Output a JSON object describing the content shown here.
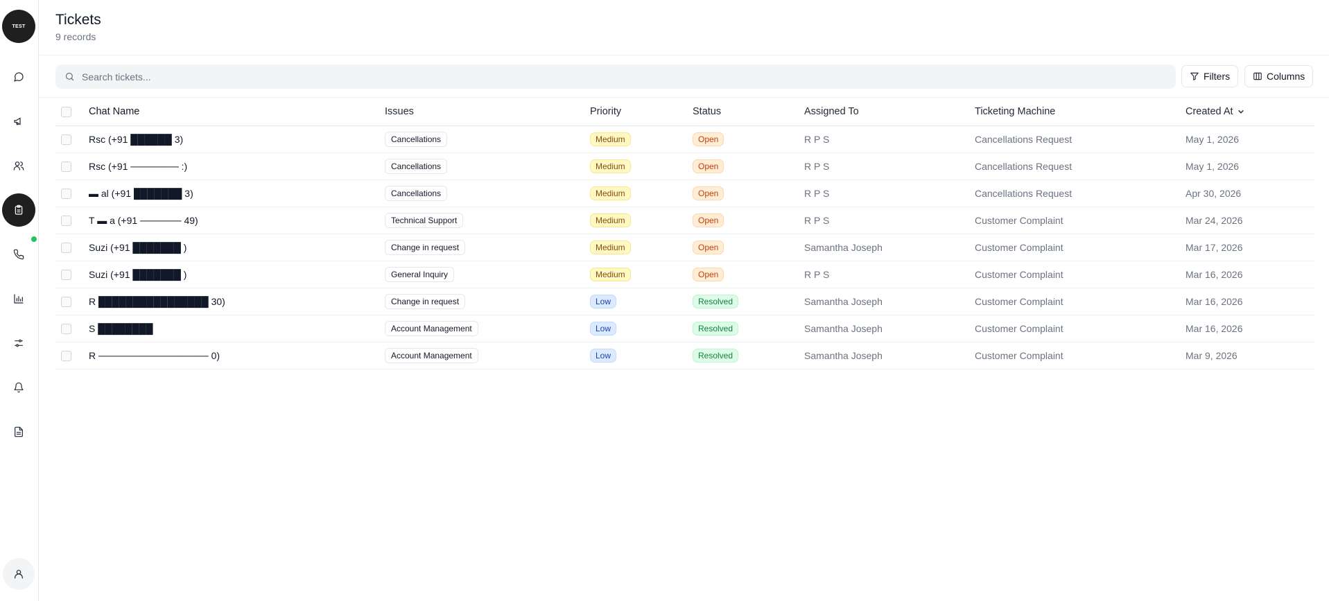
{
  "sidebar": {
    "logo_text": "TEST",
    "items": [
      {
        "name": "chat-icon",
        "top": 0
      },
      {
        "name": "megaphone-icon"
      },
      {
        "name": "users-icon"
      },
      {
        "name": "clipboard-icon",
        "active": true
      },
      {
        "name": "phone-icon"
      },
      {
        "name": "bar-chart-icon"
      },
      {
        "name": "sliders-icon"
      },
      {
        "name": "bell-icon"
      },
      {
        "name": "document-icon"
      }
    ],
    "profile_icon": "user-icon",
    "status_color": "#22c55e"
  },
  "header": {
    "title": "Tickets",
    "record_count": "9 records"
  },
  "toolbar": {
    "search_placeholder": "Search tickets...",
    "filters_label": "Filters",
    "columns_label": "Columns"
  },
  "table": {
    "columns": {
      "chat_name": "Chat Name",
      "issues": "Issues",
      "priority": "Priority",
      "status": "Status",
      "assigned_to": "Assigned To",
      "ticketing_machine": "Ticketing Machine",
      "created_at": "Created At"
    },
    "rows": [
      {
        "chat_name": "Rsc (+91 ██████ 3)",
        "issue": "Cancellations",
        "priority": "Medium",
        "status": "Open",
        "assigned_to": "R P S",
        "machine": "Cancellations Request",
        "created_at": "May 1, 2026"
      },
      {
        "chat_name": "Rsc (+91 ─────── :)",
        "issue": "Cancellations",
        "priority": "Medium",
        "status": "Open",
        "assigned_to": "R P S",
        "machine": "Cancellations Request",
        "created_at": "May 1, 2026"
      },
      {
        "chat_name": "▬ al (+91 ███████ 3)",
        "issue": "Cancellations",
        "priority": "Medium",
        "status": "Open",
        "assigned_to": "R P S",
        "machine": "Cancellations Request",
        "created_at": "Apr 30, 2026"
      },
      {
        "chat_name": "T ▬ a (+91 ────── 49)",
        "issue": "Technical Support",
        "priority": "Medium",
        "status": "Open",
        "assigned_to": "R P S",
        "machine": "Customer Complaint",
        "created_at": "Mar 24, 2026"
      },
      {
        "chat_name": "Suzi (+91 ███████ )",
        "issue": "Change in request",
        "priority": "Medium",
        "status": "Open",
        "assigned_to": "Samantha Joseph",
        "machine": "Customer Complaint",
        "created_at": "Mar 17, 2026"
      },
      {
        "chat_name": "Suzi (+91 ███████ )",
        "issue": "General Inquiry",
        "priority": "Medium",
        "status": "Open",
        "assigned_to": "R P S",
        "machine": "Customer Complaint",
        "created_at": "Mar 16, 2026"
      },
      {
        "chat_name": "R ████████████████ 30)",
        "issue": "Change in request",
        "priority": "Low",
        "status": "Resolved",
        "assigned_to": "Samantha Joseph",
        "machine": "Customer Complaint",
        "created_at": "Mar 16, 2026"
      },
      {
        "chat_name": "S ████████",
        "issue": "Account Management",
        "priority": "Low",
        "status": "Resolved",
        "assigned_to": "Samantha Joseph",
        "machine": "Customer Complaint",
        "created_at": "Mar 16, 2026"
      },
      {
        "chat_name": "R ──────────────── 0)",
        "issue": "Account Management",
        "priority": "Low",
        "status": "Resolved",
        "assigned_to": "Samantha Joseph",
        "machine": "Customer Complaint",
        "created_at": "Mar 9, 2026"
      }
    ]
  }
}
